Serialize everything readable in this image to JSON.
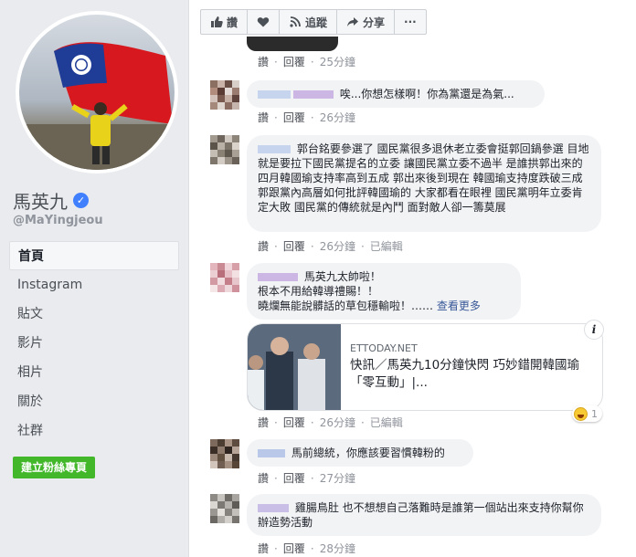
{
  "sidebar": {
    "page_name": "馬英九",
    "handle": "@MaYingjeou",
    "nav": [
      "首頁",
      "Instagram",
      "貼文",
      "影片",
      "相片",
      "關於",
      "社群"
    ],
    "create_page_button": "建立粉絲專頁"
  },
  "toolbar": {
    "like": "讚",
    "follow": "追蹤",
    "share": "分享",
    "more": "···"
  },
  "comments": [
    {
      "text": "",
      "actions": {
        "like": "讚",
        "reply": "回覆",
        "time": "25分鐘"
      }
    },
    {
      "text": "唉...你想怎樣啊！你為黨還是為氣...",
      "actions": {
        "like": "讚",
        "reply": "回覆",
        "time": "26分鐘"
      }
    },
    {
      "text": "郭台銘要參選了 國民黨很多退休老立委會挺郭回鍋參選 目地就是要拉下國民黨提名的立委 讓國民黨立委不過半 是誰拱郭出來的 四月韓國瑜支持率高到五成 郭出來後到現在 韓國瑜支持度跌破三成 郭跟黨內高層如何批評韓國瑜的 大家都看在眼裡 國民黨明年立委肯定大敗 國民黨的傳統就是內鬥 面對敵人卻一籌莫展",
      "actions": {
        "like": "讚",
        "reply": "回覆",
        "time": "26分鐘",
        "edited": "已編輯"
      }
    },
    {
      "text_lines": [
        "馬英九太帥啦！",
        "根本不用給韓導禮賜！！",
        "曉爛無能說髒話的草包穩輸啦！……"
      ],
      "see_more": "查看更多",
      "link": {
        "domain": "ETTODAY.NET",
        "title": "快訊／馬英九10分鐘快閃 巧妙錯開韓國瑜「零互動」|..."
      },
      "reaction_count": "1",
      "actions": {
        "like": "讚",
        "reply": "回覆",
        "time": "26分鐘",
        "edited": "已編輯"
      }
    },
    {
      "text": "馬前總統，你應該要習慣韓粉的",
      "actions": {
        "like": "讚",
        "reply": "回覆",
        "time": "27分鐘"
      }
    },
    {
      "text": "雞腸鳥肚 也不想想自己落難時是誰第一個站出來支持你幫你辦造勢活動",
      "actions": {
        "like": "讚",
        "reply": "回覆",
        "time": "28分鐘"
      }
    }
  ],
  "colors": {
    "accent": "#4080ff",
    "link": "#385898",
    "green": "#42b72a"
  }
}
